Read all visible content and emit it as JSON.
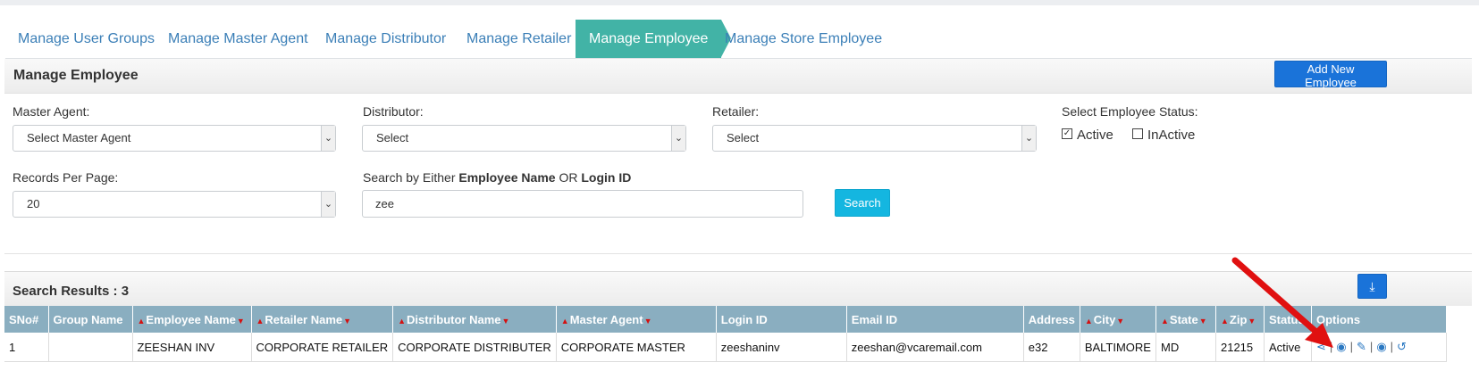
{
  "tabs": [
    {
      "label": "Manage User Groups"
    },
    {
      "label": "Manage Master Agent"
    },
    {
      "label": "Manage Distributor"
    },
    {
      "label": "Manage Retailer"
    },
    {
      "label": "Manage Employee",
      "active": true
    },
    {
      "label": "Manage Store Employee"
    }
  ],
  "panel": {
    "title": "Manage Employee",
    "add_button": "Add New Employee"
  },
  "filters": {
    "master_agent": {
      "label": "Master Agent:",
      "value": "Select Master Agent"
    },
    "distributor": {
      "label": "Distributor:",
      "value": "Select"
    },
    "retailer": {
      "label": "Retailer:",
      "value": "Select"
    },
    "status": {
      "label": "Select Employee Status:",
      "active_label": "Active",
      "inactive_label": "InActive",
      "active_checked": true,
      "inactive_checked": false
    },
    "records_per_page": {
      "label": "Records Per Page:",
      "value": "20"
    },
    "search": {
      "label_prefix": "Search by Either ",
      "label_bold1": "Employee Name",
      "label_mid": " OR ",
      "label_bold2": "Login ID",
      "value": "zee",
      "button": "Search"
    }
  },
  "results": {
    "title": "Search Results : 3",
    "columns": [
      {
        "label": "SNo#",
        "sortable": false
      },
      {
        "label": "Group Name",
        "sortable": false
      },
      {
        "label": "Employee Name",
        "sortable": true
      },
      {
        "label": "Retailer Name",
        "sortable": true
      },
      {
        "label": "Distributor Name",
        "sortable": true
      },
      {
        "label": "Master Agent",
        "sortable": true
      },
      {
        "label": "Login ID",
        "sortable": false
      },
      {
        "label": "Email ID",
        "sortable": false
      },
      {
        "label": "Address",
        "sortable": false
      },
      {
        "label": "City",
        "sortable": true
      },
      {
        "label": "State",
        "sortable": true
      },
      {
        "label": "Zip",
        "sortable": true
      },
      {
        "label": "Status",
        "sortable": false
      },
      {
        "label": "Options",
        "sortable": false
      }
    ],
    "rows": [
      {
        "sno": "1",
        "group": "",
        "employee": "ZEESHAN INV",
        "retailer": "CORPORATE RETAILER",
        "distributor": "CORPORATE DISTRIBUTER",
        "master": "CORPORATE MASTER",
        "login": "zeeshaninv",
        "email": "zeeshan@vcaremail.com",
        "address": "e32",
        "city": "BALTIMORE",
        "state": "MD",
        "zip": "21215",
        "status": "Active"
      }
    ]
  },
  "colors": {
    "tab_active": "#42b3a6",
    "link": "#3b7fb7",
    "primary": "#1a73d9",
    "info": "#14b6e0",
    "table_header": "#8aaec0",
    "arrow": "#e01010"
  },
  "icons": {
    "option_icons": [
      "sitemap-icon",
      "user-lock-icon",
      "pencil-icon",
      "eye-icon",
      "undo-icon"
    ]
  }
}
